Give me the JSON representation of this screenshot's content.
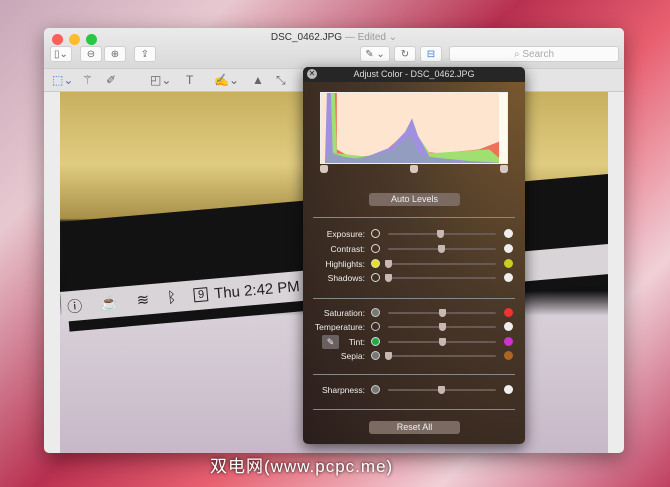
{
  "window": {
    "title": "DSC_0462.JPG",
    "edited": "— Edited",
    "search_placeholder": "Search"
  },
  "photo": {
    "time": "Thu 2:42 PM",
    "calendar_day": "9"
  },
  "panel": {
    "title": "Adjust Color - DSC_0462.JPG",
    "auto_levels": "Auto Levels",
    "reset_all": "Reset All",
    "levels": {
      "black": 0.02,
      "mid": 0.5,
      "white": 0.98
    },
    "sliders": [
      {
        "label": "Exposure:",
        "value": 0.48
      },
      {
        "label": "Contrast:",
        "value": 0.49
      },
      {
        "label": "Highlights:",
        "value": 0.0
      },
      {
        "label": "Shadows:",
        "value": 0.0
      },
      {
        "label": "Saturation:",
        "value": 0.5
      },
      {
        "label": "Temperature:",
        "value": 0.5
      },
      {
        "label": "Tint:",
        "value": 0.5
      },
      {
        "label": "Sepia:",
        "value": 0.0
      },
      {
        "label": "Sharpness:",
        "value": 0.49
      }
    ]
  },
  "watermark": "双电网(www.pcpc.me)"
}
